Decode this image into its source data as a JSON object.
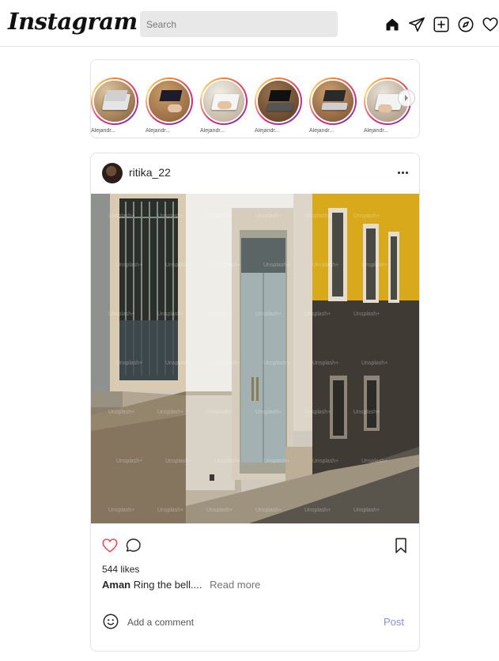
{
  "app": {
    "logo": "Instagram"
  },
  "nav": {
    "search_placeholder": "Search",
    "icons": [
      "home-icon",
      "direct-icon",
      "new-post-icon",
      "explore-icon",
      "activity-icon"
    ]
  },
  "stories": {
    "items": [
      {
        "label": "Alejandr..."
      },
      {
        "label": "Alejandr..."
      },
      {
        "label": "Alejandr..."
      },
      {
        "label": "Alejandr..."
      },
      {
        "label": "Alejandr..."
      },
      {
        "label": "Alejandr..."
      }
    ]
  },
  "post": {
    "username": "ritika_22",
    "likes": "544 likes",
    "caption_author": "Aman",
    "caption_text": "Ring the bell....",
    "read_more": "Read more",
    "comment_placeholder": "Add a comment",
    "post_button": "Post",
    "watermark": "Unsplash+"
  },
  "colors": {
    "like_heart": "#ed4956",
    "post_button": "#8c8cd6",
    "wall_yellow": "#d8a91a"
  }
}
